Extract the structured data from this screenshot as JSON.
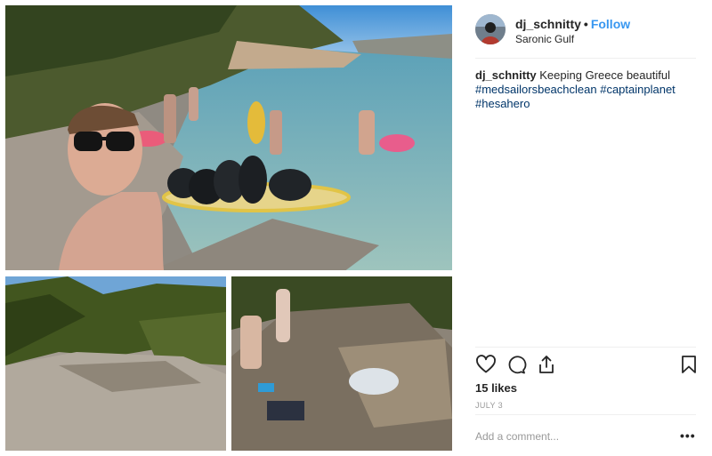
{
  "post": {
    "username": "dj_schnitty",
    "follow_label": "Follow",
    "separator": "•",
    "location": "Saronic Gulf",
    "caption_username": "dj_schnitty",
    "caption_text": "Keeping Greece beautiful",
    "hashtags": [
      "#medsailorsbeachclean",
      "#captainplanet",
      "#hesahero"
    ],
    "likes": "15 likes",
    "date": "JULY 3",
    "comment_placeholder": "Add a comment...",
    "more_label": "•••"
  },
  "icons": {
    "like": "heart-icon",
    "comment": "comment-icon",
    "share": "share-icon",
    "save": "bookmark-icon"
  },
  "colors": {
    "link": "#3897f0",
    "hashtag": "#003569",
    "text": "#262626",
    "muted": "#999999",
    "divider": "#efefef"
  }
}
